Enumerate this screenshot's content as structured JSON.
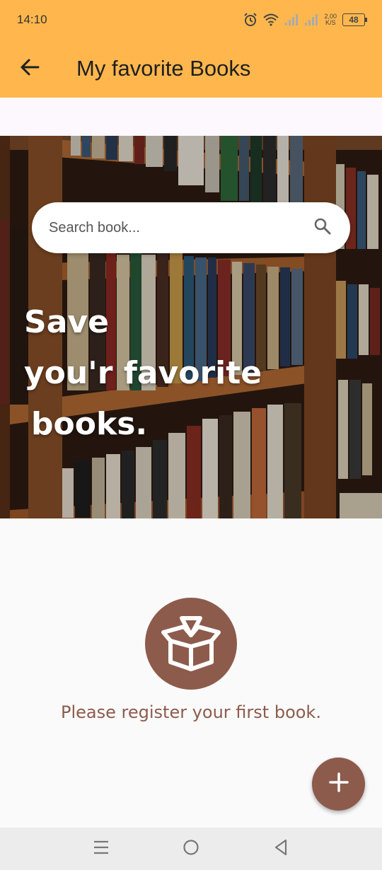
{
  "status_bar": {
    "time": "14:10",
    "speed_value": "2,00",
    "speed_unit": "K/S",
    "battery": "48",
    "icons": [
      "alarm-icon",
      "wifi-icon",
      "signal-icon",
      "signal-icon-2",
      "battery-icon"
    ]
  },
  "app_bar": {
    "title": "My favorite Books",
    "back_icon": "arrow-left-icon"
  },
  "search": {
    "placeholder": "Search book...",
    "icon": "search-icon"
  },
  "hero": {
    "line1": "Save",
    "line2": "you'r favorite",
    "line3": "books."
  },
  "empty_state": {
    "icon": "open-box-icon",
    "message": "Please register your first book."
  },
  "fab": {
    "icon": "plus-icon"
  },
  "nav_bar": {
    "icons": [
      "menu-icon",
      "home-circle-icon",
      "back-triangle-icon"
    ]
  },
  "colors": {
    "app_bar": "#FFB74D",
    "accent_brown": "#8D5B4C",
    "background": "#fafafa"
  }
}
